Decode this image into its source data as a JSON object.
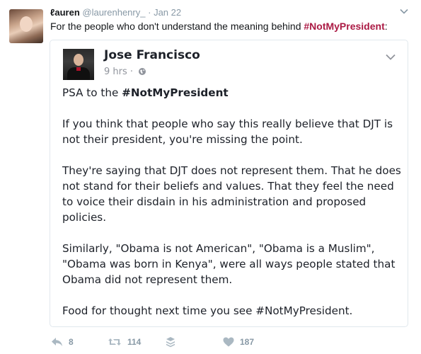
{
  "tweet": {
    "display_name": "ℓauren",
    "username": "@laurenhenry_",
    "dot": "·",
    "timestamp": "Jan 22",
    "text_before": "For the people who don't understand the meaning behind ",
    "hashtag": "#NotMyPresident",
    "text_after": ":"
  },
  "facebook_post": {
    "author": "Jose Francisco",
    "time": "9 hrs ·",
    "lines": {
      "p1_prefix": "PSA to the ",
      "p1_hashtag": "#NotMyPresident",
      "p2": "If you think that people who say this really believe that DJT is not their president, you're missing the point.",
      "p3": "They're saying that DJT does not represent them. That he does not stand for their beliefs and values. That they feel the need to voice their disdain in his administration and proposed policies.",
      "p4": "Similarly, \"Obama is not American\", \"Obama is a Muslim\", \"Obama was born in Kenya\", were all ways people stated that Obama did not represent them.",
      "p5": "Food for thought next time you see #NotMyPresident."
    }
  },
  "actions": {
    "reply_count": "8",
    "retweet_count": "114",
    "like_count": "187"
  },
  "icons": {
    "reply": "reply-icon",
    "retweet": "retweet-icon",
    "moments": "stack-icon",
    "like": "heart-icon",
    "caret": "chevron-down-icon",
    "globe": "globe-icon"
  },
  "colors": {
    "hashtag": "#ab1a44",
    "muted": "#8899a6",
    "card_border": "#e1e8ed"
  }
}
